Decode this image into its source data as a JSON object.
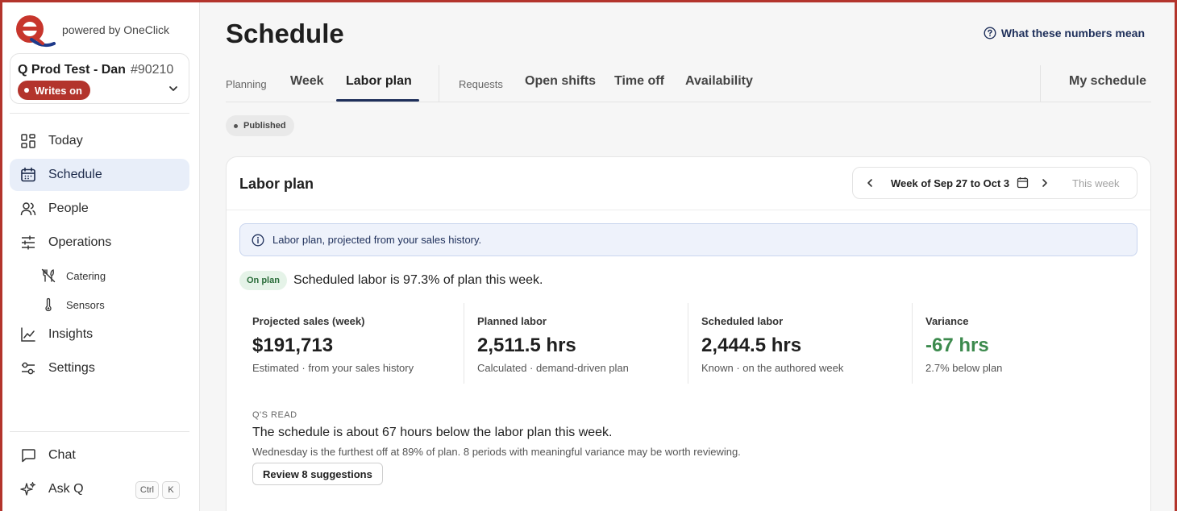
{
  "brand": {
    "powered_by": "powered by OneClick",
    "logo_color": "#c7352c",
    "logo_accent": "#1e3a8a"
  },
  "store": {
    "name": "Q Prod Test - Dan",
    "id": "#90210",
    "writes_badge": "Writes on"
  },
  "sidebar": {
    "items": [
      {
        "label": "Today",
        "icon": "grid-icon"
      },
      {
        "label": "Schedule",
        "icon": "calendar-icon",
        "active": true
      },
      {
        "label": "People",
        "icon": "people-icon"
      },
      {
        "label": "Operations",
        "icon": "sliders-icon"
      }
    ],
    "sub_items": [
      {
        "label": "Catering",
        "icon": "utensils-off-icon"
      },
      {
        "label": "Sensors",
        "icon": "thermometer-icon"
      }
    ],
    "more_items": [
      {
        "label": "Insights",
        "icon": "line-chart-icon"
      },
      {
        "label": "Settings",
        "icon": "settings-icon"
      }
    ],
    "bottom": {
      "chat": "Chat",
      "ask_q": "Ask Q",
      "shortcut": [
        "Ctrl",
        "K"
      ]
    }
  },
  "header": {
    "title": "Schedule",
    "help_link": "What these numbers mean"
  },
  "tabs": {
    "planning_label": "Planning",
    "planning": [
      "Week",
      "Labor plan"
    ],
    "active": "Labor plan",
    "requests_label": "Requests",
    "requests": [
      "Open shifts",
      "Time off",
      "Availability"
    ],
    "my_schedule": "My schedule"
  },
  "status": "Published",
  "card": {
    "title": "Labor plan",
    "week_label": "Week of Sep 27 to Oct 3",
    "this_week": "This week",
    "info": "Labor plan, projected from your sales history.",
    "on_plan_badge": "On plan",
    "on_plan_text": "Scheduled labor is 97.3% of plan this week.",
    "stats": [
      {
        "label": "Projected sales (week)",
        "value": "$191,713",
        "sub": "Estimated · from your sales history"
      },
      {
        "label": "Planned labor",
        "value": "2,511.5 hrs",
        "sub": "Calculated · demand-driven plan"
      },
      {
        "label": "Scheduled labor",
        "value": "2,444.5 hrs",
        "sub": "Known · on the authored week"
      },
      {
        "label": "Variance",
        "value": "-67 hrs",
        "sub": "2.7% below plan",
        "color": "#3c8a4d"
      }
    ],
    "read": {
      "label": "Q'S READ",
      "title": "The schedule is about 67 hours below the labor plan this week.",
      "detail": "Wednesday is the furthest off at 89% of plan. 8 periods with meaningful variance may be worth reviewing.",
      "button": "Review 8 suggestions"
    }
  }
}
